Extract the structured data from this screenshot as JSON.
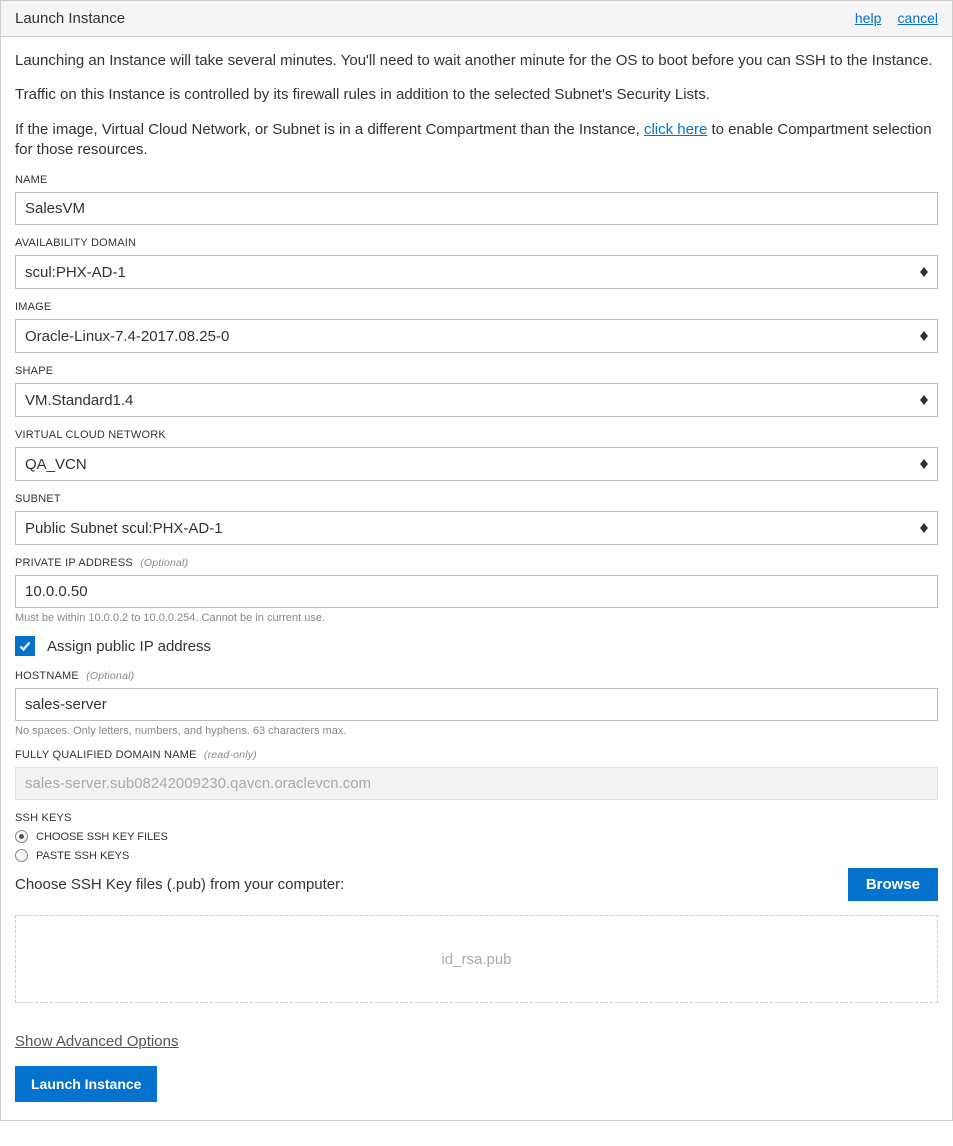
{
  "header": {
    "title": "Launch Instance",
    "help_label": "help",
    "cancel_label": "cancel"
  },
  "intro": {
    "p1": "Launching an Instance will take several minutes. You'll need to wait another minute for the OS to boot before you can SSH to the Instance.",
    "p2": "Traffic on this Instance is controlled by its firewall rules in addition to the selected Subnet's Security Lists.",
    "p3_before": "If the image, Virtual Cloud Network, or Subnet is in a different Compartment than the Instance, ",
    "p3_link": "click here",
    "p3_after": " to enable Compartment selection for those resources."
  },
  "fields": {
    "name": {
      "label": "NAME",
      "value": "SalesVM"
    },
    "availability_domain": {
      "label": "AVAILABILITY DOMAIN",
      "value": "scul:PHX-AD-1"
    },
    "image": {
      "label": "IMAGE",
      "value": "Oracle-Linux-7.4-2017.08.25-0"
    },
    "shape": {
      "label": "SHAPE",
      "value": "VM.Standard1.4"
    },
    "vcn": {
      "label": "VIRTUAL CLOUD NETWORK",
      "value": "QA_VCN"
    },
    "subnet": {
      "label": "SUBNET",
      "value": "Public Subnet scul:PHX-AD-1"
    },
    "private_ip": {
      "label": "PRIVATE IP ADDRESS",
      "optional": "(Optional)",
      "value": "10.0.0.50",
      "help": "Must be within 10.0.0.2 to 10.0.0.254. Cannot be in current use."
    },
    "assign_public_ip": {
      "label": "Assign public IP address",
      "checked": true
    },
    "hostname": {
      "label": "HOSTNAME",
      "optional": "(Optional)",
      "value": "sales-server",
      "help": "No spaces. Only letters, numbers, and hyphens. 63 characters max."
    },
    "fqdn": {
      "label": "FULLY QUALIFIED DOMAIN NAME",
      "readonly_tag": "(read-only)",
      "value": "sales-server.sub08242009230.qavcn.oraclevcn.com"
    },
    "ssh": {
      "label": "SSH KEYS",
      "option_files": "CHOOSE SSH KEY FILES",
      "option_paste": "PASTE SSH KEYS",
      "prompt": "Choose SSH Key files (.pub) from your computer:",
      "browse": "Browse",
      "file": "id_rsa.pub"
    }
  },
  "footer": {
    "advanced": "Show Advanced Options",
    "launch": "Launch Instance"
  }
}
